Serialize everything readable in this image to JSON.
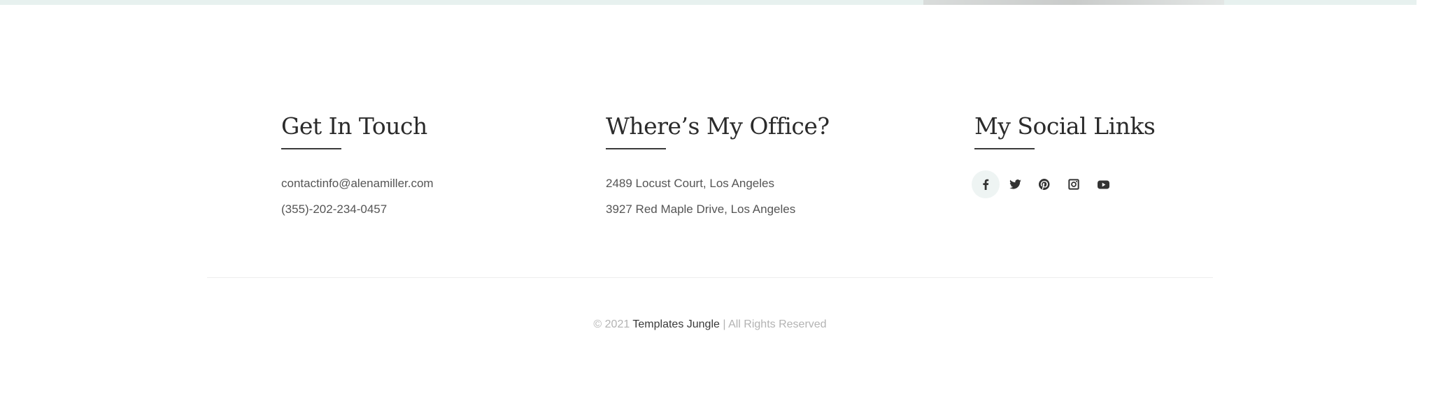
{
  "footer": {
    "contact": {
      "title": "Get In Touch",
      "email": "contactinfo@alenamiller.com",
      "phone": "(355)-202-234-0457"
    },
    "office": {
      "title": "Where’s My Office?",
      "addresses": [
        "2489  Locust Court, Los Angeles",
        "3927  Red Maple Drive, Los Angeles"
      ]
    },
    "social": {
      "title": "My Social Links",
      "icons": [
        "facebook-icon",
        "twitter-icon",
        "pinterest-icon",
        "instagram-icon",
        "youtube-icon"
      ]
    }
  },
  "copyright": {
    "prefix": "© 2021 ",
    "brand": "Templates Jungle",
    "suffix": " | All Rights Reserved"
  },
  "colors": {
    "heading": "#2b2b2b",
    "body_text": "#555555",
    "muted": "#b3b3b3",
    "active_icon_bg": "#eef4f3"
  }
}
